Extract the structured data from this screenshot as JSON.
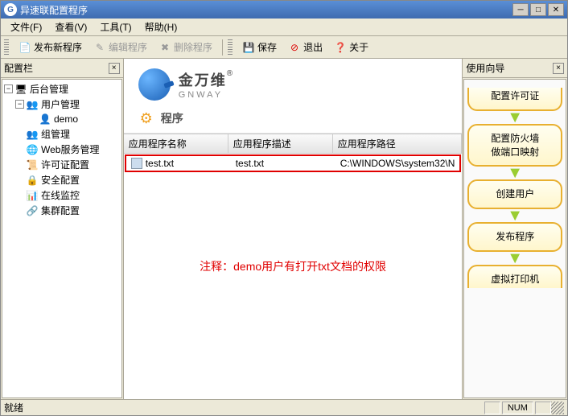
{
  "window": {
    "title": "异速联配置程序"
  },
  "menu": {
    "file": "文件(F)",
    "view": "查看(V)",
    "tools": "工具(T)",
    "help": "帮助(H)"
  },
  "toolbar": {
    "publish": "发布新程序",
    "edit": "编辑程序",
    "delete": "删除程序",
    "save": "保存",
    "exit": "退出",
    "about": "关于"
  },
  "leftpanel": {
    "title": "配置栏"
  },
  "tree": {
    "root": "后台管理",
    "user_mgmt": "用户管理",
    "demo": "demo",
    "group_mgmt": "组管理",
    "web_svc": "Web服务管理",
    "license": "许可证配置",
    "security": "安全配置",
    "monitor": "在线监控",
    "cluster": "集群配置"
  },
  "brand": {
    "cn": "金万维",
    "reg": "®",
    "en": "GNWAY"
  },
  "section": {
    "title": "程序"
  },
  "columns": {
    "name": "应用程序名称",
    "desc": "应用程序描述",
    "path": "应用程序路径"
  },
  "rows": [
    {
      "name": "test.txt",
      "desc": "test.txt",
      "path": "C:\\WINDOWS\\system32\\N"
    }
  ],
  "annotation": "注释：demo用户有打开txt文档的权限",
  "rightpanel": {
    "title": "使用向导"
  },
  "wizard": {
    "step1": "配置许可证",
    "step2a": "配置防火墙",
    "step2b": "做端口映射",
    "step3": "创建用户",
    "step4": "发布程序",
    "step5": "虚拟打印机"
  },
  "status": {
    "text": "就绪",
    "num": "NUM"
  }
}
